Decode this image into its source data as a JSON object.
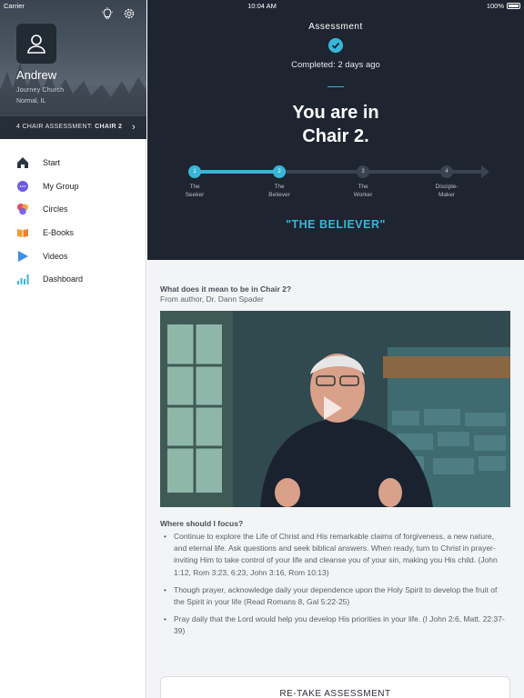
{
  "status_bar": {
    "carrier": "Carrier",
    "time": "10:04 AM",
    "battery": "100%"
  },
  "sidebar": {
    "user_name": "Andrew",
    "church": "Journey Church",
    "location": "Normal, IL",
    "assessment_prefix": "4 CHAIR ASSESSMENT:",
    "assessment_value": "CHAIR 2",
    "nav": [
      {
        "label": "Start",
        "icon": "home-icon",
        "color": "#2a3442"
      },
      {
        "label": "My Group",
        "icon": "chat-bubble-icon",
        "color": "#6c5ce7"
      },
      {
        "label": "Circles",
        "icon": "circles-icon",
        "color": "#e84b6b"
      },
      {
        "label": "E-Books",
        "icon": "book-icon",
        "color": "#f39c34"
      },
      {
        "label": "Videos",
        "icon": "play-icon",
        "color": "#3b8fe8"
      },
      {
        "label": "Dashboard",
        "icon": "bar-chart-icon",
        "color": "#38b6d8"
      }
    ]
  },
  "header": {
    "label": "Assessment",
    "completed": "Completed: 2 days ago",
    "result_line1": "You are in",
    "result_line2": "Chair 2.",
    "steps": [
      {
        "number": "1",
        "line1": "The",
        "line2": "Seeker",
        "state": "active"
      },
      {
        "number": "2",
        "line1": "The",
        "line2": "Believer",
        "state": "active"
      },
      {
        "number": "3",
        "line1": "The",
        "line2": "Worker",
        "state": "inactive"
      },
      {
        "number": "4",
        "line1": "Disciple-",
        "line2": "Maker",
        "state": "inactive"
      }
    ],
    "chair_name": "\"THE BELIEVER\"",
    "accent": "#38b6d8"
  },
  "content": {
    "question_title": "What does it mean to be in Chair 2?",
    "question_author": "From author, Dr. Dann Spader",
    "focus_title": "Where should I focus?",
    "bullets": [
      "Continue to explore the Life of Christ and His remarkable claims of forgiveness, a new nature, and eternal life. Ask questions and seek biblical answers. When ready, turn to Christ in prayer-inviting Him to take control of your life and cleanse you of your sin, making you His child. (John 1:12, Rom 3:23, 6:23, John 3:16, Rom 10:13)",
      "Though prayer, acknowledge daily your dependence upon the Holy Spirit to develop the fruit of the Spirit in your life (Read Romans 8, Gal 5:22-25)",
      "Pray daily that the Lord would help you develop His priorities in your life. (I John 2:6, Matt. 22:37-39)"
    ],
    "retake_label": "RE-TAKE ASSESSMENT"
  }
}
